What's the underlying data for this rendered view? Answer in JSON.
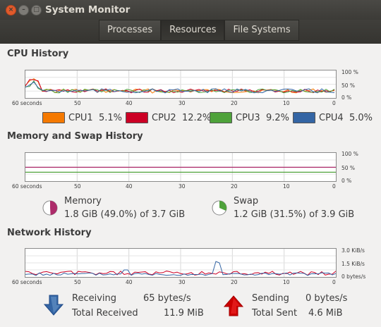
{
  "window": {
    "title": "System Monitor"
  },
  "tabs": [
    {
      "label": "Processes",
      "active": false
    },
    {
      "label": "Resources",
      "active": true
    },
    {
      "label": "File Systems",
      "active": false
    }
  ],
  "icons": {
    "close": "close-icon",
    "minimize": "minimize-icon",
    "maximize": "maximize-icon",
    "receiving": "arrow-down-icon",
    "sending": "arrow-up-icon"
  },
  "cpu": {
    "title": "CPU History",
    "x_ticks": [
      "60 seconds",
      "50",
      "40",
      "30",
      "20",
      "10",
      "0"
    ],
    "y_ticks": [
      "100 %",
      "50 %",
      "0 %"
    ],
    "legend": [
      {
        "name": "CPU1",
        "value": "5.1%",
        "color": "#f57900"
      },
      {
        "name": "CPU2",
        "value": "12.2%",
        "color": "#cc0025"
      },
      {
        "name": "CPU3",
        "value": "9.2%",
        "color": "#4ea23a"
      },
      {
        "name": "CPU4",
        "value": "5.0%",
        "color": "#3465a4"
      }
    ]
  },
  "memory": {
    "title": "Memory and Swap History",
    "x_ticks": [
      "60 seconds",
      "50",
      "40",
      "30",
      "20",
      "10",
      "0"
    ],
    "y_ticks": [
      "100 %",
      "50 %",
      "0 %"
    ],
    "memory_label": "Memory",
    "memory_value": "1.8 GiB (49.0%) of 3.7 GiB",
    "memory_fraction": 0.49,
    "memory_color": "#ad2b6a",
    "swap_label": "Swap",
    "swap_value": "1.2 GiB (31.5%) of 3.9 GiB",
    "swap_fraction": 0.315,
    "swap_color": "#4ea23a"
  },
  "network": {
    "title": "Network History",
    "x_ticks": [
      "60 seconds",
      "50",
      "40",
      "30",
      "20",
      "10",
      "0"
    ],
    "y_ticks": [
      "3.0 KiB/s",
      "1.5 KiB/s",
      "0 bytes/s"
    ],
    "receiving_label": "Receiving",
    "receiving_value": "65 bytes/s",
    "total_received_label": "Total Received",
    "total_received_value": "11.9 MiB",
    "sending_label": "Sending",
    "sending_value": "0 bytes/s",
    "total_sent_label": "Total Sent",
    "total_sent_value": "4.6 MiB",
    "receiving_color": "#3465a4",
    "sending_color": "#cc0025"
  }
}
